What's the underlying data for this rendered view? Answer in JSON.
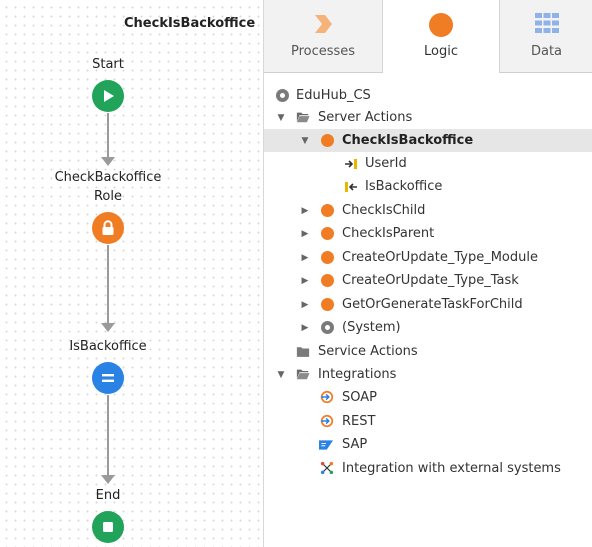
{
  "flow": {
    "title": "CheckIsBackoffice",
    "nodes": [
      {
        "label": "Start",
        "kind": "start",
        "icon": "play-icon",
        "color": "#21a35a"
      },
      {
        "label": "CheckBackoffice\nRole",
        "kind": "check-role",
        "icon": "lock-icon",
        "color": "#f07d23"
      },
      {
        "label": "IsBackoffice",
        "kind": "assign",
        "icon": "equals-icon",
        "color": "#2a82e4"
      },
      {
        "label": "End",
        "kind": "end",
        "icon": "stop-icon",
        "color": "#21a35a"
      }
    ]
  },
  "tabs": [
    {
      "label": "Processes",
      "icon": "processes-chevron-icon",
      "active": false
    },
    {
      "label": "Logic",
      "icon": "logic-circle-icon",
      "active": true
    },
    {
      "label": "Data",
      "icon": "data-grid-icon",
      "active": false
    }
  ],
  "tree": {
    "module": "EduHub_CS",
    "server_actions": {
      "label": "Server Actions",
      "items": [
        {
          "label": "CheckIsBackoffice",
          "selected": true,
          "expanded": true,
          "params": [
            {
              "label": "UserId",
              "kind": "input"
            },
            {
              "label": "IsBackoffice",
              "kind": "output"
            }
          ]
        },
        {
          "label": "CheckIsChild"
        },
        {
          "label": "CheckIsParent"
        },
        {
          "label": "CreateOrUpdate_Type_Module"
        },
        {
          "label": "CreateOrUpdate_Type_Task"
        },
        {
          "label": "GetOrGenerateTaskForChild"
        },
        {
          "label": "(System)",
          "system": true
        }
      ]
    },
    "service_actions": {
      "label": "Service Actions"
    },
    "integrations": {
      "label": "Integrations",
      "items": [
        {
          "label": "SOAP",
          "icon": "soap-icon"
        },
        {
          "label": "REST",
          "icon": "rest-icon"
        },
        {
          "label": "SAP",
          "icon": "sap-icon"
        },
        {
          "label": "Integration with external systems",
          "icon": "external-integration-icon"
        }
      ]
    }
  },
  "colors": {
    "accent_orange": "#f07d23",
    "start_end_green": "#21a35a",
    "assign_blue": "#2a82e4",
    "selection_bg": "#e6e6e6"
  }
}
